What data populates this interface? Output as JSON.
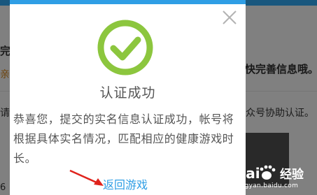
{
  "background": {
    "right_text_1": "快完善信息哦。",
    "right_text_2": "众号协助认证。",
    "left_text_1": "完",
    "left_text_2": "亲",
    "left_text_3": "请",
    "left_text_4": "6"
  },
  "dialog": {
    "title": "认证成功",
    "message": "恭喜您，提交的实名信息认证成功，帐号将根据具体实名情况，匹配相应的健康游戏时长。",
    "return_link": "返回游戏",
    "close_icon": "close-icon",
    "success_icon": "check-circle-icon",
    "accent_color": "#2f9ee5",
    "success_color": "#8cc63e"
  },
  "watermark": {
    "brand": "Baidu",
    "word": "经验",
    "url": "jingyan.baidu.com"
  }
}
